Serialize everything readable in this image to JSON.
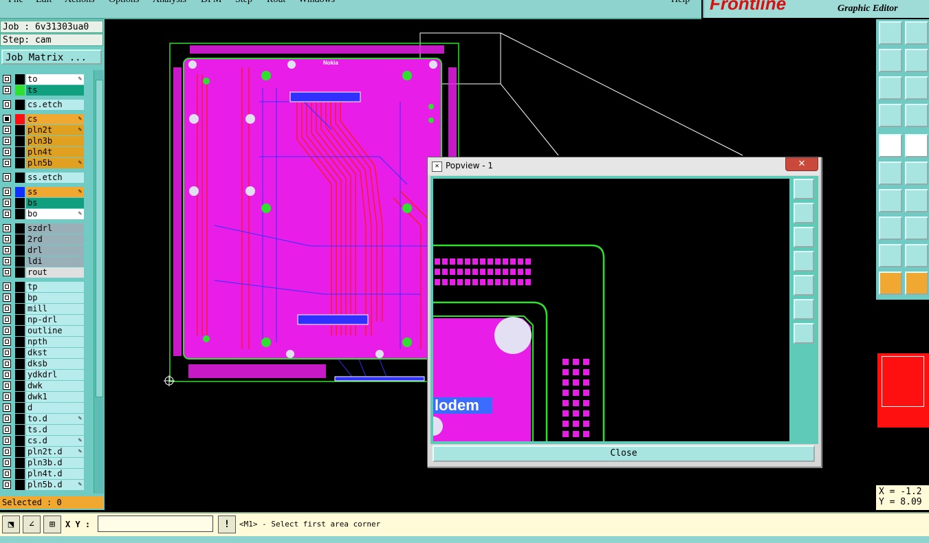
{
  "menu": [
    "File",
    "Edit",
    "Actions",
    "Options",
    "Analysis",
    "DFM",
    "Step",
    "Rout",
    "Windows"
  ],
  "help": "Help",
  "brand": {
    "logo": "Frontline",
    "subtitle": "Graphic Editor"
  },
  "job": {
    "job_line": "Job : 6v31303ua0",
    "step_line": "Step: cam",
    "matrix_button": "Job Matrix ..."
  },
  "layers": [
    {
      "name": "to",
      "bg": "#ffffff",
      "swatch": "#000000",
      "checked": false,
      "editable": true
    },
    {
      "name": "ts",
      "bg": "#10a080",
      "swatch": "#30e030",
      "checked": false,
      "editable": false
    },
    {
      "name": "cs.etch",
      "bg": "#b8ecec",
      "swatch": "#000000",
      "checked": false,
      "editable": false
    },
    {
      "name": "cs",
      "bg": "#f0a830",
      "swatch": "#ff1010",
      "checked": true,
      "editable": true
    },
    {
      "name": "pln2t",
      "bg": "#e0a020",
      "swatch": "#000000",
      "checked": false,
      "editable": true
    },
    {
      "name": "pln3b",
      "bg": "#e0a020",
      "swatch": "#000000",
      "checked": false,
      "editable": false
    },
    {
      "name": "pln4t",
      "bg": "#e0a020",
      "swatch": "#000000",
      "checked": false,
      "editable": false
    },
    {
      "name": "pln5b",
      "bg": "#e0a020",
      "swatch": "#000000",
      "checked": false,
      "editable": true
    },
    {
      "name": "ss.etch",
      "bg": "#b8ecec",
      "swatch": "#000000",
      "checked": false,
      "editable": false
    },
    {
      "name": "ss",
      "bg": "#f0a830",
      "swatch": "#1030ff",
      "checked": false,
      "editable": true
    },
    {
      "name": "bs",
      "bg": "#10a080",
      "swatch": "#000000",
      "checked": false,
      "editable": false
    },
    {
      "name": "bo",
      "bg": "#ffffff",
      "swatch": "#000000",
      "checked": false,
      "editable": true
    },
    {
      "name": "szdrl",
      "bg": "#9ab0b8",
      "swatch": "#000000",
      "checked": false,
      "editable": false
    },
    {
      "name": "2rd",
      "bg": "#9ab0b8",
      "swatch": "#000000",
      "checked": false,
      "editable": false
    },
    {
      "name": "drl",
      "bg": "#9ab0b8",
      "swatch": "#000000",
      "checked": false,
      "editable": false
    },
    {
      "name": "ldi",
      "bg": "#9ab0b8",
      "swatch": "#000000",
      "checked": false,
      "editable": false
    },
    {
      "name": "rout",
      "bg": "#e0e0e0",
      "swatch": "#000000",
      "checked": false,
      "editable": false
    },
    {
      "name": "tp",
      "bg": "#b8ecec",
      "swatch": "#000000",
      "checked": false,
      "editable": false
    },
    {
      "name": "bp",
      "bg": "#b8ecec",
      "swatch": "#000000",
      "checked": false,
      "editable": false
    },
    {
      "name": "mill",
      "bg": "#b8ecec",
      "swatch": "#000000",
      "checked": false,
      "editable": false
    },
    {
      "name": "np-drl",
      "bg": "#b8ecec",
      "swatch": "#000000",
      "checked": false,
      "editable": false
    },
    {
      "name": "outline",
      "bg": "#b8ecec",
      "swatch": "#000000",
      "checked": false,
      "editable": false
    },
    {
      "name": "npth",
      "bg": "#b8ecec",
      "swatch": "#000000",
      "checked": false,
      "editable": false
    },
    {
      "name": "dkst",
      "bg": "#b8ecec",
      "swatch": "#000000",
      "checked": false,
      "editable": false
    },
    {
      "name": "dksb",
      "bg": "#b8ecec",
      "swatch": "#000000",
      "checked": false,
      "editable": false
    },
    {
      "name": "ydkdrl",
      "bg": "#b8ecec",
      "swatch": "#000000",
      "checked": false,
      "editable": false
    },
    {
      "name": "dwk",
      "bg": "#b8ecec",
      "swatch": "#000000",
      "checked": false,
      "editable": false
    },
    {
      "name": "dwk1",
      "bg": "#b8ecec",
      "swatch": "#000000",
      "checked": false,
      "editable": false
    },
    {
      "name": "d",
      "bg": "#b8ecec",
      "swatch": "#000000",
      "checked": false,
      "editable": false
    },
    {
      "name": "to.d",
      "bg": "#b8ecec",
      "swatch": "#000000",
      "checked": false,
      "editable": true
    },
    {
      "name": "ts.d",
      "bg": "#b8ecec",
      "swatch": "#000000",
      "checked": false,
      "editable": false
    },
    {
      "name": "cs.d",
      "bg": "#b8ecec",
      "swatch": "#000000",
      "checked": false,
      "editable": true
    },
    {
      "name": "pln2t.d",
      "bg": "#b8ecec",
      "swatch": "#000000",
      "checked": false,
      "editable": true
    },
    {
      "name": "pln3b.d",
      "bg": "#b8ecec",
      "swatch": "#000000",
      "checked": false,
      "editable": false
    },
    {
      "name": "pln4t.d",
      "bg": "#b8ecec",
      "swatch": "#000000",
      "checked": false,
      "editable": false
    },
    {
      "name": "pln5b.d",
      "bg": "#b8ecec",
      "swatch": "#000000",
      "checked": false,
      "editable": true
    }
  ],
  "selected": "Selected : 0",
  "xy_label": "X Y :",
  "xy_value": "",
  "prompt": "<M1> - Select first area corner",
  "coords": {
    "x": "X = -1.2",
    "y": "Y = 8.09"
  },
  "popview": {
    "title": "Popview - 1",
    "close_x": "✕",
    "close_button": "Close",
    "board_text": "lodem"
  },
  "board": {
    "label": "Nokia"
  },
  "colors": {
    "panel": "#6fcbc4",
    "board": "#e81ee8",
    "outline": "#30e030",
    "accent": "#f0a830"
  }
}
